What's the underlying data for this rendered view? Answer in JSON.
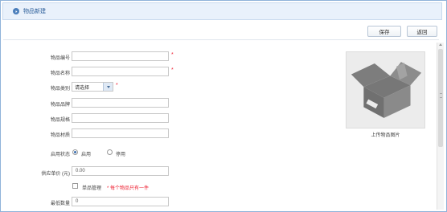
{
  "header": {
    "title": "物品新建"
  },
  "toolbar": {
    "save_label": "保存",
    "back_label": "返回"
  },
  "form": {
    "code_label": "物品编号",
    "code_value": "",
    "name_label": "物品名称",
    "name_value": "",
    "category_label": "物品类别",
    "category_selected": "请选择",
    "brand_label": "物品品牌",
    "spec_label": "物品规格",
    "material_label": "物品材质",
    "status_label": "启用状态",
    "status_options": [
      "启用",
      "停用"
    ],
    "status_selected": "启用",
    "price_label": "供应单价 (元)",
    "price_value": "0.00",
    "single_manage_label": "单品管理",
    "single_manage_hint": "* 每个物品只有一件",
    "min_qty_label": "最低数量",
    "min_qty_value": "0",
    "required_mark": "*"
  },
  "image_upload": {
    "caption": "上传物品图片"
  },
  "colors": {
    "accent": "#3a6fb0",
    "required": "#e23333",
    "header_bg": "#e9f1fb"
  }
}
